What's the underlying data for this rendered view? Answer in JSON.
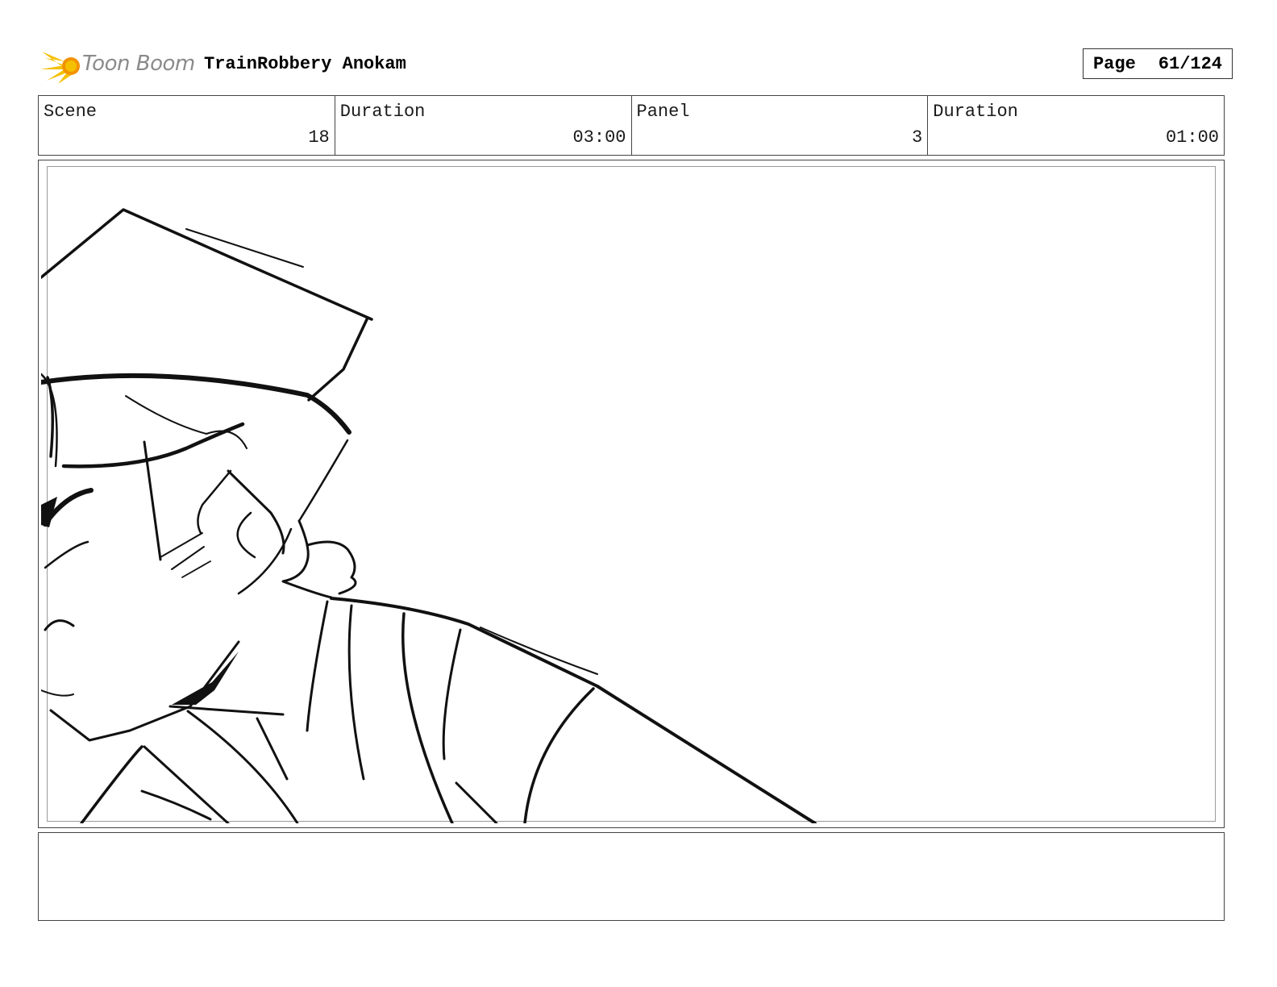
{
  "header": {
    "logo_text": "Toon Boom",
    "project_title": "TrainRobbery Anokam",
    "page_label": "Page",
    "page_number": "61/124"
  },
  "info": {
    "scene_label": "Scene",
    "scene_value": "18",
    "scene_duration_label": "Duration",
    "scene_duration_value": "03:00",
    "panel_label": "Panel",
    "panel_value": "3",
    "panel_duration_label": "Duration",
    "panel_duration_value": "01:00"
  },
  "panel": {
    "image": "sketch-drawing"
  },
  "notes": {
    "text": ""
  },
  "colors": {
    "logo_yellow": "#f5c000",
    "logo_orange": "#f39200",
    "logo_text": "#8a8a8a",
    "border": "#444444",
    "inner_border": "#9a9a9a"
  }
}
